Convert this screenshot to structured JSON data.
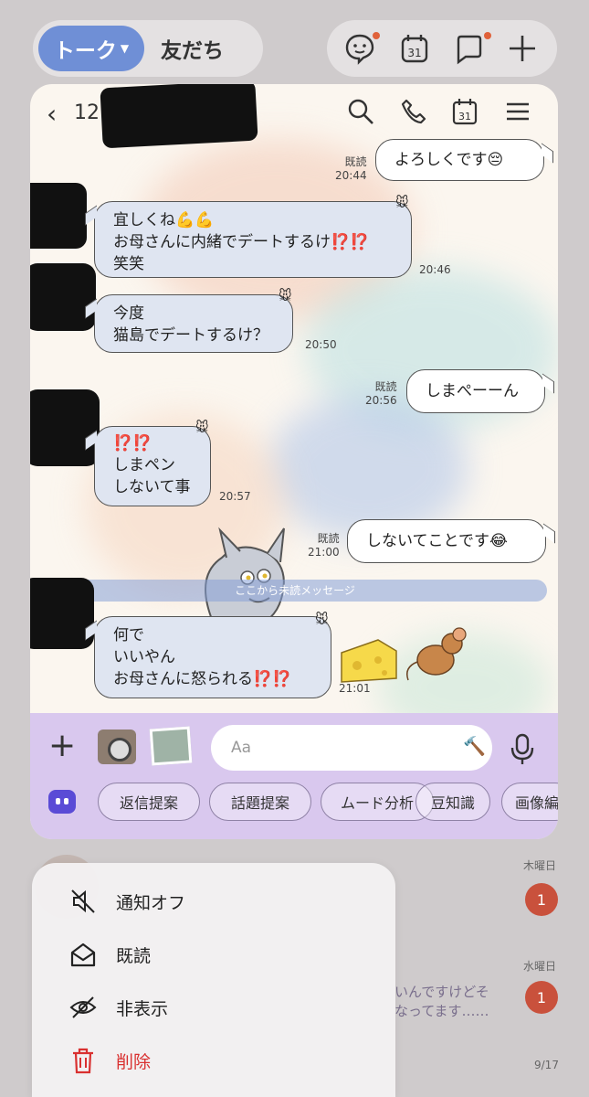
{
  "top_bar": {
    "talk_tab": "トーク",
    "friends_tab": "友だち",
    "icons": [
      "chat-bubble-face-icon",
      "calendar-icon",
      "new-chat-icon",
      "add-icon"
    ],
    "calendar_day": "31"
  },
  "chat": {
    "member_count": "12",
    "header_icons": [
      "search-icon",
      "phone-icon",
      "calendar-icon",
      "menu-icon"
    ],
    "calendar_day": "31",
    "messages": [
      {
        "side": "out",
        "text": "よろしくです😔",
        "read": "既読",
        "time": "20:44"
      },
      {
        "side": "in",
        "text": "宜しくね💪💪\nお母さんに内緒でデートするけ⁉️⁉️\n笑笑",
        "time": "20:46"
      },
      {
        "side": "in",
        "text": "今度\n猫島でデートするけ？",
        "time": "20:50"
      },
      {
        "side": "out",
        "text": "しまぺーーん",
        "read": "既読",
        "time": "20:56"
      },
      {
        "side": "in",
        "text": "⁉️⁉️\nしまペン\nしないて事",
        "time": "20:57"
      },
      {
        "side": "out",
        "text": "しないてことです😂",
        "read": "既読",
        "time": "21:00"
      },
      {
        "side": "in",
        "text": "何で\nいいやん\nお母さんに怒られる⁉️⁉️",
        "time": "21:01"
      }
    ],
    "unread_divider": "ここから未読メッセージ",
    "input_placeholder": "Aa",
    "suggestion_chips": [
      "返信提案",
      "話題提案",
      "ムード分析",
      "豆知識",
      "画像編"
    ]
  },
  "background_list": [
    {
      "date": "木曜日",
      "badge": "1"
    },
    {
      "date": "水曜日",
      "badge": "1",
      "preview_line1": "いんですけどそ",
      "preview_line2": "なってます……"
    },
    {
      "date": "9/17"
    }
  ],
  "context_menu": {
    "items": [
      {
        "label": "通知オフ",
        "icon": "mute-icon"
      },
      {
        "label": "既読",
        "icon": "open-envelope-icon"
      },
      {
        "label": "非表示",
        "icon": "hidden-eye-icon"
      },
      {
        "label": "削除",
        "icon": "trash-icon"
      }
    ],
    "danger_color": "#d93030"
  },
  "colors": {
    "accent": "#6f8fd6",
    "incoming_bubble": "#dfe5f1",
    "input_bar": "#d9c8ee",
    "badge": "#c9513c"
  }
}
